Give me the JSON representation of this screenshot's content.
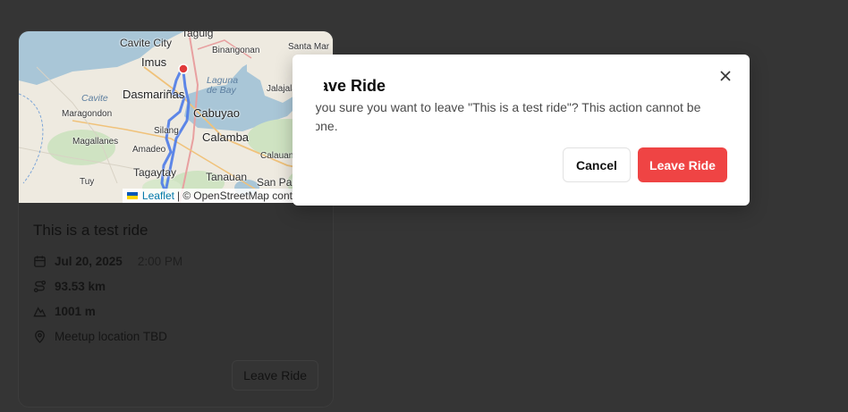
{
  "card": {
    "title": "This is a test ride",
    "date": "Jul 20, 2025",
    "time": "2:00 PM",
    "distance": "93.53 km",
    "elevation": "1001 m",
    "meetup": "Meetup location TBD",
    "leave_button": "Leave Ride"
  },
  "map": {
    "labels": {
      "cavite_city": "Cavite City",
      "taguig": "Taguig",
      "santa_maria": "Santa Mar",
      "imus": "Imus",
      "binangonan": "Binangonan",
      "cavite": "Cavite",
      "dasmarinas": "Dasmariñas",
      "laguna_de_bay": "Laguna\nde Bay",
      "jalajala": "Jalajala",
      "maragondon": "Maragondon",
      "cabuyao": "Cabuyao",
      "silang": "Silang",
      "magallanes": "Magallanes",
      "calamba": "Calamba",
      "amadeo": "Amadeo",
      "calauan": "Calauan",
      "tagaytay": "Tagaytay",
      "tanauan": "Tanauan",
      "san_pablo": "San Pablo",
      "tuy": "Tuy"
    },
    "attribution": {
      "leaflet": "Leaflet",
      "separator": "| ©",
      "osm": "OpenStreetMap contributors"
    }
  },
  "dialog": {
    "title": "Leave Ride",
    "body": "Are you sure you want to leave \"This is a test ride\"? This action cannot be undone.",
    "cancel": "Cancel",
    "confirm": "Leave Ride",
    "close_icon": "close-icon"
  },
  "colors": {
    "overlay": "#353535",
    "danger": "#ef4444",
    "route": "#4c7be8",
    "pin": "#e03a3a"
  }
}
